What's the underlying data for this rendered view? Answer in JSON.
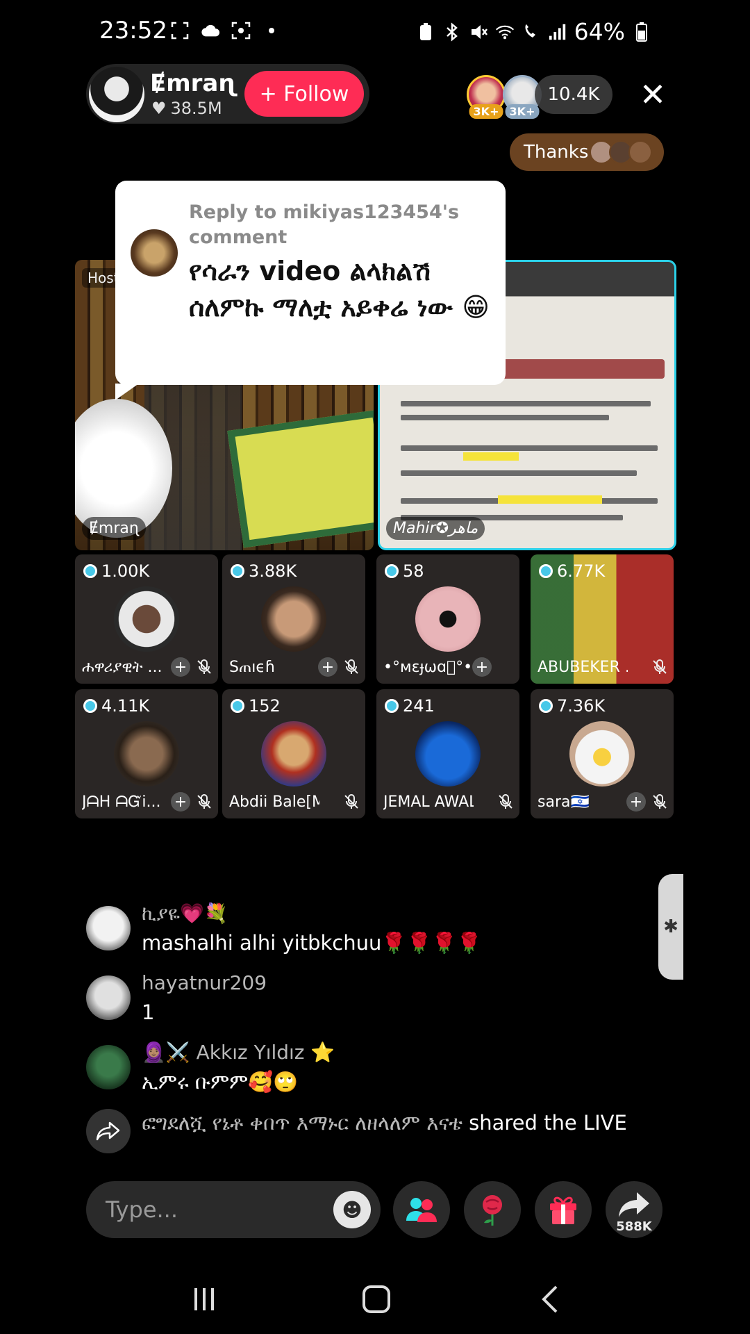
{
  "status_bar": {
    "time": "23:52",
    "battery": "64%"
  },
  "host": {
    "name": "Ɇmraɳ",
    "likes": "38.5M",
    "follow_label": "+ Follow"
  },
  "top_viewers": [
    {
      "badge": "3K+",
      "badge_color": "#e8a21a"
    },
    {
      "badge": "3K+",
      "badge_color": "#8aa6c0"
    }
  ],
  "viewer_count": "10.4K",
  "close_icon": "close-icon",
  "thanks_label": "Thanks",
  "reply_bubble": {
    "reply_to": "Reply to mikiyas123454's comment",
    "text": "የሳራን video ልላክልሽ ሰለምኩ ማለቷ አይቀሬ ነው 😁"
  },
  "video_tiles": {
    "host_tag": "Host",
    "left_name": "Ɇmraɳ",
    "right_name": "Mahir✪ماهر"
  },
  "guests": [
    {
      "gifts": "1.00K",
      "name": "ሐዋሪያዊት ..."
    },
    {
      "gifts": "3.88K",
      "name": "Sጠıϵɦ"
    },
    {
      "gifts": "58",
      "name": "•°ᴍɛɟωɑ᪲°•"
    },
    {
      "gifts": "6.77K",
      "name": "ABUBEKER ..."
    },
    {
      "gifts": "4.11K",
      "name": "JᗩH ᗩᏳi..."
    },
    {
      "gifts": "152",
      "name": "Abdii Bale[M..."
    },
    {
      "gifts": "241",
      "name": "JEMAL AWAL"
    },
    {
      "gifts": "7.36K",
      "name": "sara🇮🇱"
    }
  ],
  "comments": [
    {
      "user": "ኪያዬ💗💐",
      "text": "mashalhi alhi yitbkchuu🌹🌹🌹🌹"
    },
    {
      "user": "hayatnur209",
      "text": "1"
    },
    {
      "user": "🧕🏽⚔️ Akkız Yıldız ⭐",
      "text": "ኢምሩ ቡምም🥰🙄"
    }
  ],
  "share_event": {
    "user": "ፎግደለሿ የኔቶ ቀበጥ  እማኑር ለዘላለም እናቴ",
    "action": "shared the LIVE"
  },
  "bottom_bar": {
    "type_placeholder": "Type...",
    "share_count": "588K"
  },
  "colors": {
    "follow": "#fe2c55",
    "accent_cyan": "#2bd0e8",
    "thanks_pill": "#6b4321"
  }
}
